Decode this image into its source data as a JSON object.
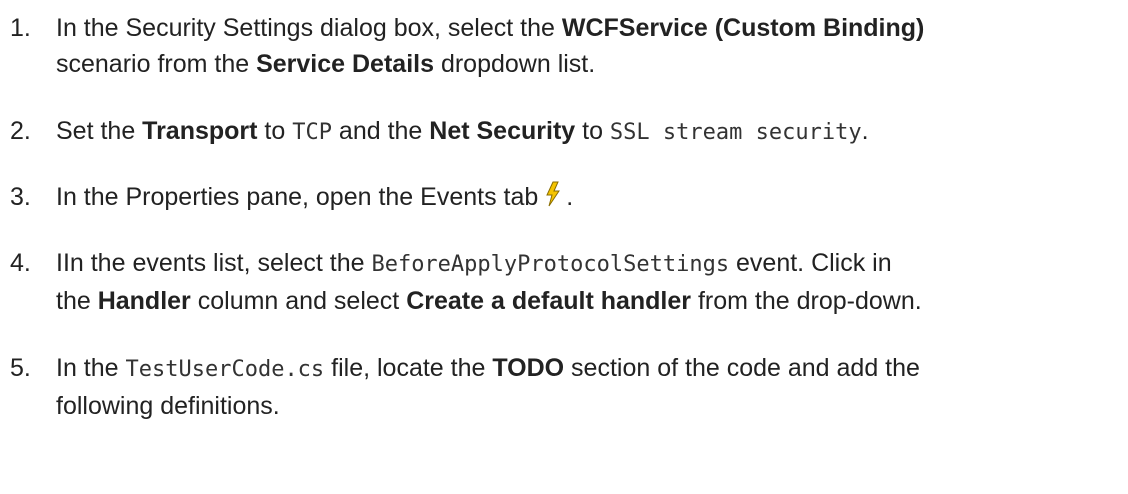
{
  "steps": [
    {
      "number": "1.",
      "p1": "In the Security Settings dialog box, select the ",
      "b1": "WCFService (Custom Binding)",
      "p2": "scenario from the ",
      "b2": "Service Details",
      "p3": " dropdown list."
    },
    {
      "number": "2.",
      "p1": "Set the ",
      "b1": "Transport",
      "p2": " to ",
      "c1": "TCP",
      "p3": " and the ",
      "b2": "Net Security",
      "p4": " to ",
      "c2": "SSL stream security",
      "p5": "."
    },
    {
      "number": "3.",
      "p1": "In the Properties pane, open the Events tab",
      "p2": "."
    },
    {
      "number": "4.",
      "p1": "IIn the events list, select the ",
      "c1": "BeforeApplyProtocolSettings",
      "p2": " event. Click in",
      "p3": "the ",
      "b1": "Handler",
      "p4": " column and select ",
      "b2": "Create a default handler",
      "p5": " from the drop-down."
    },
    {
      "number": "5.",
      "p1": "In the ",
      "c1": "TestUserCode.cs",
      "p2": " file, locate the ",
      "b1": "TODO",
      "p3": " section of the code and add the",
      "p4": "following definitions."
    }
  ],
  "icons": {
    "events_tab": "lightning-bolt-icon"
  },
  "colors": {
    "text": "#222222",
    "icon_yellow": "#f5c400"
  }
}
